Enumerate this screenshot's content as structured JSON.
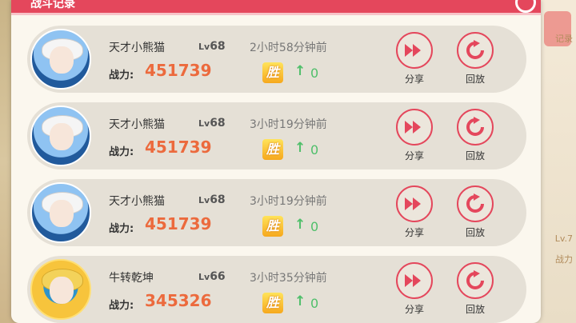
{
  "header": {
    "title": "战斗记录"
  },
  "background": {
    "right_texts": [
      "记录",
      "Lv.7",
      "战力"
    ]
  },
  "colors": {
    "accent": "#e4475c",
    "power": "#ec6a3d",
    "gain": "#4fbf6a"
  },
  "records": [
    {
      "name": "天才小熊猫",
      "lv_prefix": "Lv",
      "lv": "68",
      "power_label": "战力:",
      "power": "451739",
      "time": "2小时58分钟前",
      "result": "胜",
      "arrow": "↑",
      "delta": "0",
      "share": "分享",
      "replay": "回放",
      "avatar": "white-hair-trainer-avatar"
    },
    {
      "name": "天才小熊猫",
      "lv_prefix": "Lv",
      "lv": "68",
      "power_label": "战力:",
      "power": "451739",
      "time": "3小时19分钟前",
      "result": "胜",
      "arrow": "↑",
      "delta": "0",
      "share": "分享",
      "replay": "回放",
      "avatar": "white-hair-trainer-avatar"
    },
    {
      "name": "天才小熊猫",
      "lv_prefix": "Lv",
      "lv": "68",
      "power_label": "战力:",
      "power": "451739",
      "time": "3小时19分钟前",
      "result": "胜",
      "arrow": "↑",
      "delta": "0",
      "share": "分享",
      "replay": "回放",
      "avatar": "white-hair-trainer-avatar"
    },
    {
      "name": "牛转乾坤",
      "lv_prefix": "Lv",
      "lv": "66",
      "power_label": "战力:",
      "power": "345326",
      "time": "3小时35分钟前",
      "result": "胜",
      "arrow": "↑",
      "delta": "0",
      "share": "分享",
      "replay": "回放",
      "avatar": "gold-frame-trainer-avatar"
    }
  ]
}
